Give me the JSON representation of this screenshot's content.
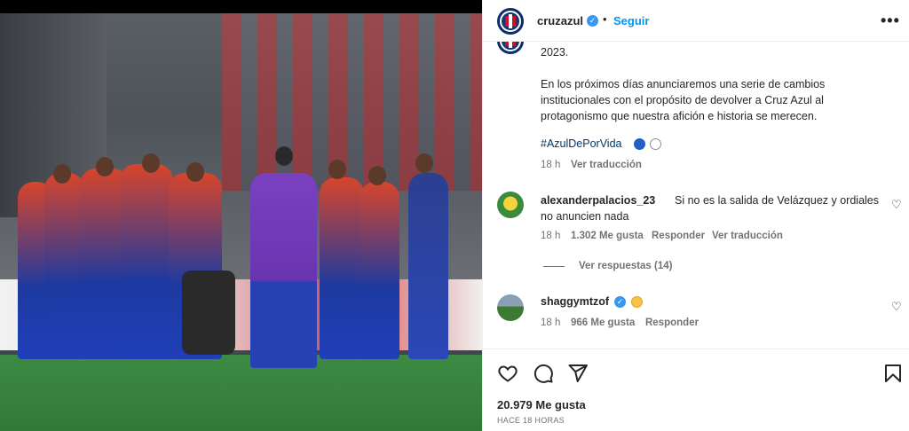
{
  "post": {
    "account": {
      "username": "cruzazul",
      "verified_icon": "verified-badge-icon",
      "follow_label": "Seguir",
      "more_icon": "more-options-icon"
    },
    "caption": {
      "year_line": "2023.",
      "body": "En los próximos días anunciaremos una serie de cambios institucionales con el propósito de devolver a Cruz Azul al protagonismo que nuestra afición e historia se merecen.",
      "hashtag": "#AzulDePorVida",
      "time": "18 h",
      "translate": "Ver traducción"
    },
    "comments": [
      {
        "username": "alexanderpalacios_23",
        "text": "Si no es la salida de Velázquez y ordiales no anuncien nada",
        "time": "18 h",
        "likes": "1.302 Me gusta",
        "reply": "Responder",
        "translate": "Ver traducción",
        "view_replies": "Ver respuestas (14)"
      },
      {
        "username": "shaggymtzof",
        "text": "",
        "time": "18 h",
        "likes": "966 Me gusta",
        "reply": "Responder"
      }
    ],
    "footer": {
      "likes": "20.979 Me gusta",
      "time_ago": "HACE 18 HORAS"
    }
  },
  "colors": {
    "link_blue": "#0095f6",
    "hashtag": "#00376b",
    "muted": "#737373",
    "verified": "#3897f0"
  }
}
